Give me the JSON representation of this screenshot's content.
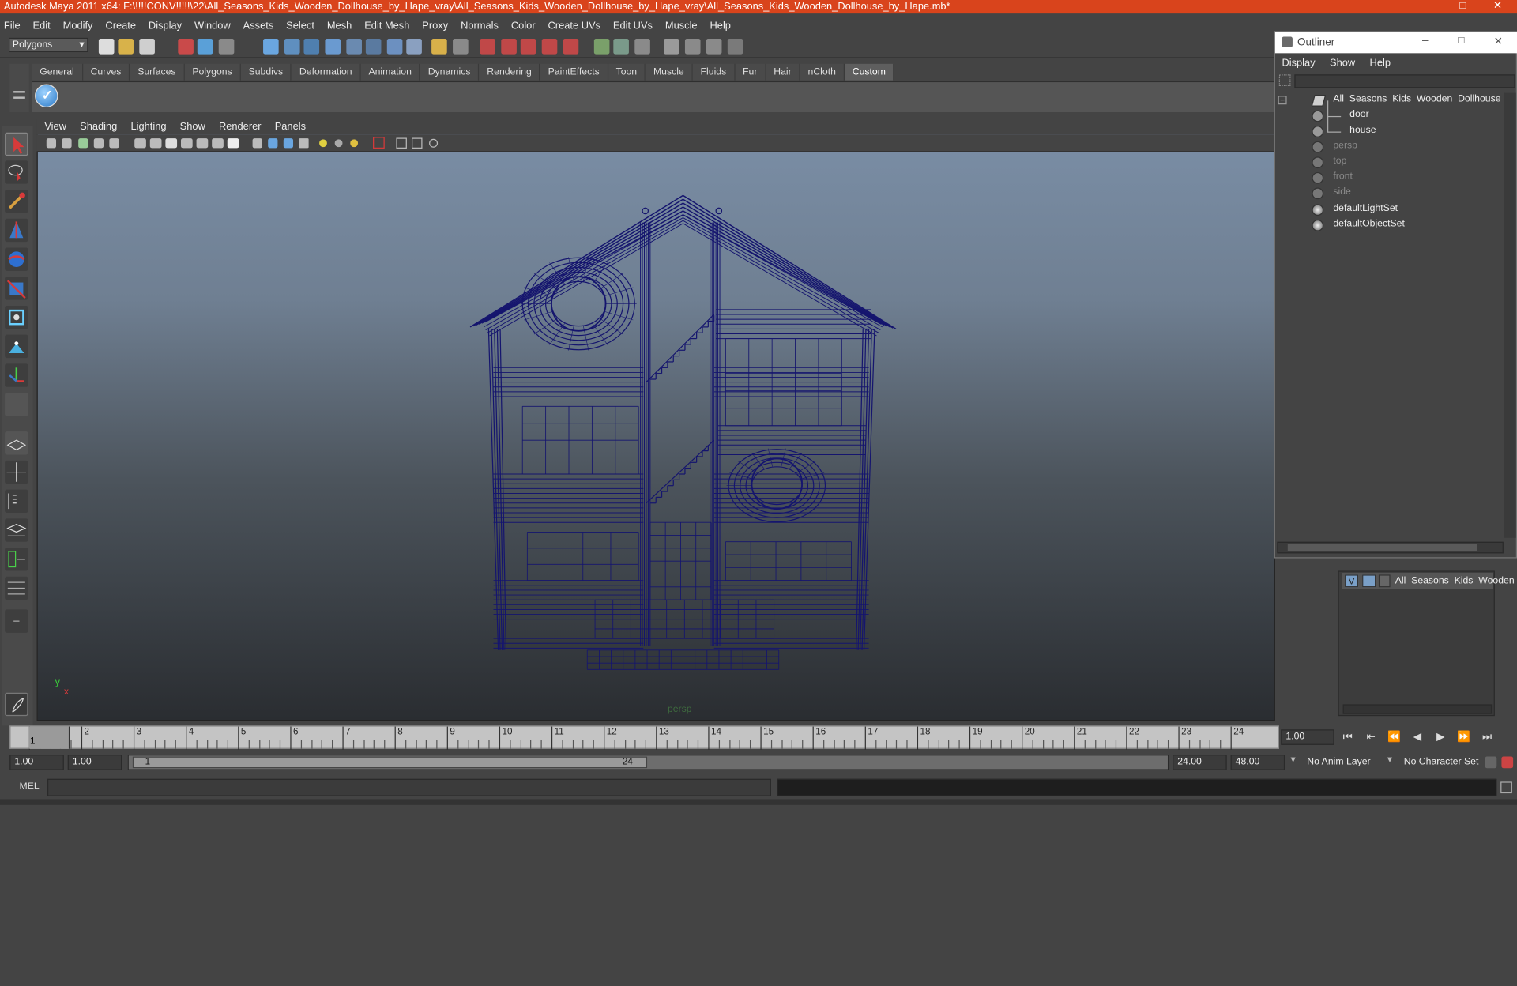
{
  "window": {
    "title": "Autodesk Maya 2011 x64: F:\\!!!!CONV!!!!!\\22\\All_Seasons_Kids_Wooden_Dollhouse_by_Hape_vray\\All_Seasons_Kids_Wooden_Dollhouse_by_Hape_vray\\All_Seasons_Kids_Wooden_Dollhouse_by_Hape.mb*",
    "minimize": "–",
    "maximize": "□",
    "close": "✕"
  },
  "menubar": [
    "File",
    "Edit",
    "Modify",
    "Create",
    "Display",
    "Window",
    "Assets",
    "Select",
    "Mesh",
    "Edit Mesh",
    "Proxy",
    "Normals",
    "Color",
    "Create UVs",
    "Edit UVs",
    "Muscle",
    "Help"
  ],
  "statusline": {
    "mode": "Polygons"
  },
  "shelf": {
    "tabs": [
      "General",
      "Curves",
      "Surfaces",
      "Polygons",
      "Subdivs",
      "Deformation",
      "Animation",
      "Dynamics",
      "Rendering",
      "PaintEffects",
      "Toon",
      "Muscle",
      "Fluids",
      "Fur",
      "Hair",
      "nCloth",
      "Custom"
    ],
    "active_tab": "Custom"
  },
  "viewport": {
    "menu": [
      "View",
      "Shading",
      "Lighting",
      "Show",
      "Renderer",
      "Panels"
    ],
    "camera_label": "persp",
    "axis_y": "y",
    "axis_x": "x",
    "wire_color": "#15156e"
  },
  "outliner": {
    "title": "Outliner",
    "menu": [
      "Display",
      "Show",
      "Help"
    ],
    "items": [
      {
        "label": "All_Seasons_Kids_Wooden_Dollhouse_by_Ha"
      },
      {
        "label": "door"
      },
      {
        "label": "house"
      },
      {
        "label": "persp"
      },
      {
        "label": "top"
      },
      {
        "label": "front"
      },
      {
        "label": "side"
      },
      {
        "label": "defaultLightSet"
      },
      {
        "label": "defaultObjectSet"
      }
    ]
  },
  "layers": {
    "visible": "V",
    "name": "All_Seasons_Kids_Wooden"
  },
  "timeslider": {
    "ticks": [
      "1",
      "2",
      "3",
      "4",
      "5",
      "6",
      "7",
      "8",
      "9",
      "10",
      "11",
      "12",
      "13",
      "14",
      "15",
      "16",
      "17",
      "18",
      "19",
      "20",
      "21",
      "22",
      "23",
      "24"
    ],
    "current_frame": "1",
    "current_time": "1.00"
  },
  "range": {
    "start_time": "1.00",
    "playback_start": "1.00",
    "range_start": "1",
    "range_end": "24",
    "playback_end": "24.00",
    "end_time": "48.00",
    "anim_layer": "No Anim Layer",
    "character_set": "No Character Set"
  },
  "cmdline": {
    "label": "MEL"
  }
}
